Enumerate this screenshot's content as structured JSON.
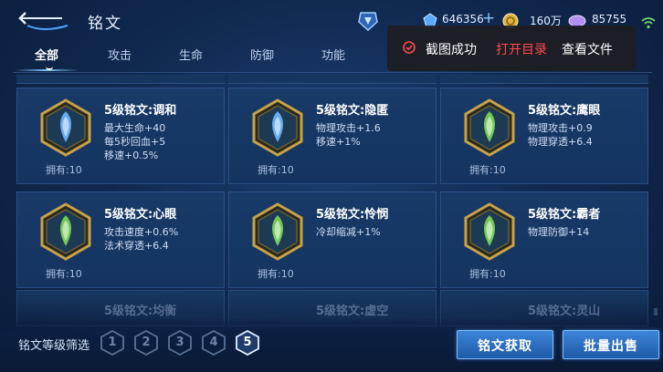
{
  "header": {
    "title": "铭文",
    "resources": [
      {
        "icon": "diamond-icon",
        "value": "646356",
        "plus": "+"
      },
      {
        "icon": "gold-coin-icon",
        "value": "160万"
      },
      {
        "icon": "purple-gem-icon",
        "value": "85755"
      }
    ]
  },
  "tabs": [
    {
      "label": "全部",
      "active": true
    },
    {
      "label": "攻击"
    },
    {
      "label": "生命"
    },
    {
      "label": "防御"
    },
    {
      "label": "功能"
    }
  ],
  "toast": {
    "message": "截图成功",
    "open_label": "打开目录",
    "view_label": "查看文件"
  },
  "cards": [
    {
      "name": "5级铭文:调和",
      "stats": [
        "最大生命+40",
        "每5秒回血+5",
        "移速+0.5%"
      ],
      "owned": "拥有:10",
      "icon": "harmony-emblem-icon",
      "color": "#6fb8ff"
    },
    {
      "name": "5级铭文:隐匿",
      "stats": [
        "物理攻击+1.6",
        "移速+1%"
      ],
      "owned": "拥有:10",
      "icon": "stealth-emblem-icon",
      "color": "#6fb8ff"
    },
    {
      "name": "5级铭文:鹰眼",
      "stats": [
        "物理攻击+0.9",
        "物理穿透+6.4"
      ],
      "owned": "拥有:10",
      "icon": "hawkeye-emblem-icon",
      "color": "#7ed957"
    },
    {
      "name": "5级铭文:心眼",
      "stats": [
        "攻击速度+0.6%",
        "法术穿透+6.4"
      ],
      "owned": "拥有:10",
      "icon": "mind-eye-emblem-icon",
      "color": "#7ed957"
    },
    {
      "name": "5级铭文:怜悯",
      "stats": [
        "冷却缩减+1%"
      ],
      "owned": "拥有:10",
      "icon": "mercy-emblem-icon",
      "color": "#7ed957"
    },
    {
      "name": "5级铭文:霸者",
      "stats": [
        "物理防御+14"
      ],
      "owned": "拥有:10",
      "icon": "overlord-emblem-icon",
      "color": "#7ed957"
    }
  ],
  "partial_cards": [
    {
      "name": "5级铭文:均衡"
    },
    {
      "name": "5级铭文:虚空"
    },
    {
      "name": "5级铭文:灵山"
    }
  ],
  "bottom": {
    "filter_label": "铭文等级筛选",
    "levels": [
      "1",
      "2",
      "3",
      "4",
      "5"
    ],
    "selected_level": "5",
    "obtain_label": "铭文获取",
    "sell_label": "批量出售"
  },
  "colors": {
    "accent": "#3d85d8",
    "gold_frame": "#c8a24a",
    "toast_link": "#ff4a4a"
  }
}
